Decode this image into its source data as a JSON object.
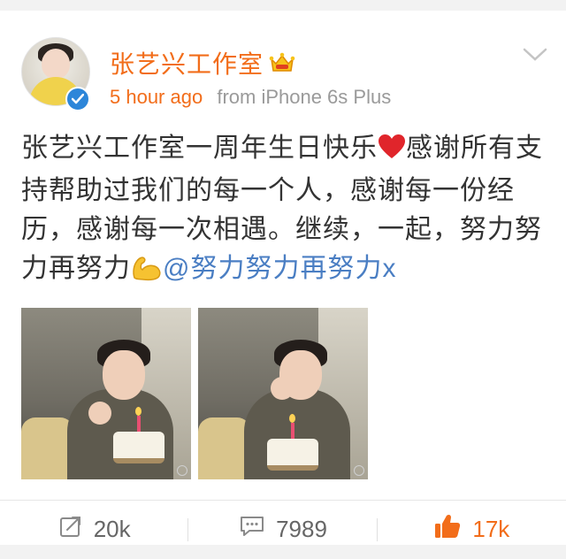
{
  "post": {
    "author": "张艺兴工作室",
    "time": "5 hour ago",
    "source": "from iPhone 6s Plus",
    "text": {
      "part1": "张艺兴工作室一周年生日快乐",
      "part2": "感谢所有支持帮助过我们的每一个人，感谢每一份经历，感谢每一次相遇。继续，一起，努力努力再努力",
      "mention": "@努力努力再努力x"
    },
    "photos": [
      "photo-1",
      "photo-2"
    ]
  },
  "actions": {
    "repost": "20k",
    "comments": "7989",
    "likes": "17k"
  },
  "colors": {
    "accent": "#f26d1a",
    "link": "#4a7ec3",
    "verified": "#2d86d9",
    "text": "#333333",
    "muted": "#9a9a9a"
  },
  "icons": {
    "crown": "vip-crown-icon",
    "verified": "verified-badge-icon",
    "heart": "heart-emoji-icon",
    "muscle": "flexed-bicep-emoji-icon",
    "repost": "repost-icon",
    "comment": "comment-icon",
    "like": "thumbs-up-icon",
    "menu": "chevron-down-icon"
  }
}
